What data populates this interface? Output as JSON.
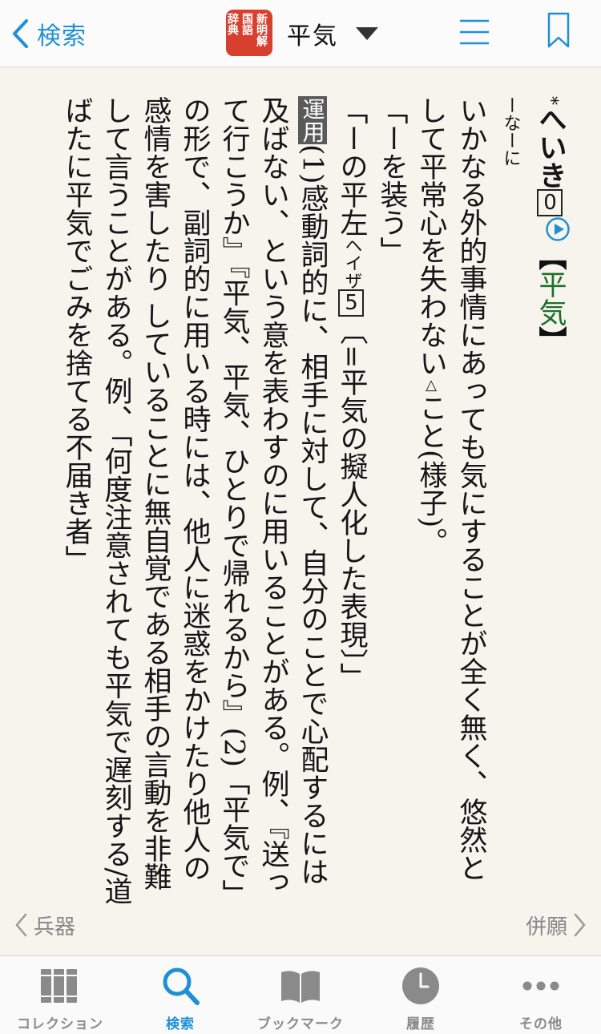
{
  "header": {
    "back_label": "検索",
    "title": "平気",
    "logo_columns": [
      "新明解",
      "国語",
      "辞典"
    ],
    "accent_color": "#1e90d6"
  },
  "entry": {
    "star": "*",
    "headword_kana": "へいき",
    "accent_number": "0",
    "kanji_headword": "平気",
    "bracket_open": "【",
    "bracket_close": "】",
    "form_note": "ーなーに",
    "definition": "いかなる外的事情にあっても気にすることが全く無く、悠然として平常心を失わない",
    "triangle": "△",
    "definition_end": "こと(様子)。",
    "example1": "「ーを装う」",
    "example2_a": "「ーの平左",
    "example2_reading": "ヘイザ",
    "example2_num": "5",
    "example2_b": "〔=平気の擬人化した表現〕」",
    "usage_label": "運用",
    "usage_text": "(1)感動詞的に、相手に対して、自分のことで心配するには及ばない、という意を表わすのに用いることがある。例、『送って行こうか』『平気、平気、ひとりで帰れるから』(2)「平気で」の形で、副詞的に用いる時には、他人に迷惑をかけたり他人の感情を害したり していることに無自覚である相手の言動を非難して言うことがある。例、「何度注意されても平気で遅刻する/道ばたに平気でごみを捨てる不届き者」"
  },
  "nav": {
    "prev_label": "兵器",
    "next_label": "併願"
  },
  "tabs": [
    {
      "label": "コレクション",
      "icon": "books-icon",
      "active": false
    },
    {
      "label": "検索",
      "icon": "search-icon",
      "active": true
    },
    {
      "label": "ブックマーク",
      "icon": "open-book-icon",
      "active": false
    },
    {
      "label": "履歴",
      "icon": "clock-icon",
      "active": false
    },
    {
      "label": "その他",
      "icon": "more-icon",
      "active": false
    }
  ]
}
